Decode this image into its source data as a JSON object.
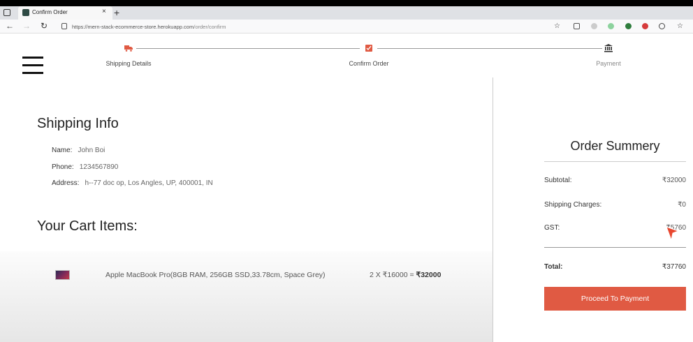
{
  "browser": {
    "tab_title": "Confirm Order",
    "tab_close": "×",
    "new_tab": "+",
    "url_host": "https://mern-stack-ecommerce-store.herokuapp.com",
    "url_path": "/order/confirm"
  },
  "stepper": {
    "steps": [
      {
        "label": "Shipping Details",
        "icon": "truck-icon",
        "active": true
      },
      {
        "label": "Confirm Order",
        "icon": "checklist-icon",
        "active": true
      },
      {
        "label": "Payment",
        "icon": "bank-icon",
        "active": false
      }
    ],
    "active_color": "#e05a43"
  },
  "shipping": {
    "title": "Shipping Info",
    "name_label": "Name:",
    "name": "John Boi",
    "phone_label": "Phone:",
    "phone": "1234567890",
    "address_label": "Address:",
    "address": "h--77 doc op, Los Angles, UP, 400001, IN"
  },
  "cart": {
    "title": "Your Cart Items:",
    "items": [
      {
        "name": "Apple MacBook Pro(8GB RAM, 256GB SSD,33.78cm, Space Grey)",
        "qty_price": "2 X ₹16000 = ",
        "total": "₹32000"
      }
    ]
  },
  "summary": {
    "title": "Order Summery",
    "subtotal_label": "Subtotal:",
    "subtotal": "₹32000",
    "shipping_label": "Shipping Charges:",
    "shipping": "₹0",
    "gst_label": "GST:",
    "gst": "₹5760",
    "total_label": "Total:",
    "total": "₹37760",
    "button": "Proceed To Payment",
    "button_color": "#e05a43"
  }
}
